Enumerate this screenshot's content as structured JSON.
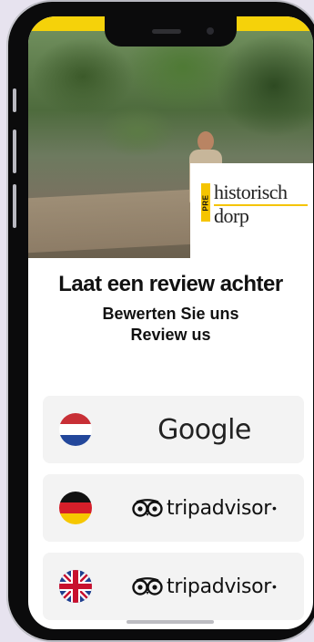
{
  "hero": {
    "logo_side_text": "PRE",
    "logo_line1": "historisch",
    "logo_line2": "dorp"
  },
  "heading": {
    "title_nl": "Laat een review achter",
    "title_de": "Bewerten Sie uns",
    "title_en": "Review us"
  },
  "buttons": [
    {
      "flag": "netherlands-flag-icon",
      "brand": "Google"
    },
    {
      "flag": "germany-flag-icon",
      "brand": "tripadvisor"
    },
    {
      "flag": "uk-flag-icon",
      "brand": "tripadvisor"
    }
  ],
  "colors": {
    "accent_yellow": "#f5c400",
    "button_bg": "#f3f3f3"
  }
}
